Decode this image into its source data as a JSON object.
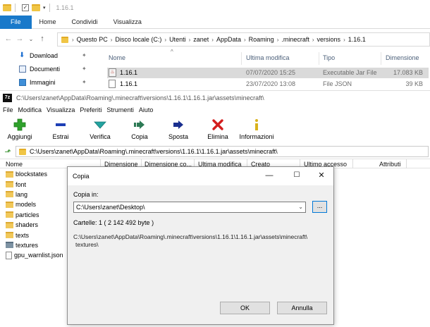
{
  "explorer": {
    "title": "1.16.1",
    "ribbon_tabs": [
      "File",
      "Home",
      "Condividi",
      "Visualizza"
    ],
    "breadcrumb": [
      "Questo PC",
      "Disco locale (C:)",
      "Utenti",
      "zanet",
      "AppData",
      "Roaming",
      ".minecraft",
      "versions",
      "1.16.1"
    ],
    "nav_items": [
      {
        "label": "Download",
        "icon": "download-icon"
      },
      {
        "label": "Documenti",
        "icon": "documents-icon"
      },
      {
        "label": "Immagini",
        "icon": "pictures-icon"
      }
    ],
    "columns": {
      "name": "Nome",
      "modified": "Ultima modifica",
      "type": "Tipo",
      "size": "Dimensione"
    },
    "files": [
      {
        "name": "1.16.1",
        "modified": "07/07/2020 15:25",
        "type": "Executable Jar File",
        "size": "17.083 KB",
        "selected": true
      },
      {
        "name": "1.16.1",
        "modified": "23/07/2020 13:08",
        "type": "File JSON",
        "size": "39 KB",
        "selected": false
      }
    ]
  },
  "zip": {
    "title": "C:\\Users\\zanet\\AppData\\Roaming\\.minecraft\\versions\\1.16.1\\1.16.1.jar\\assets\\minecraft\\",
    "menu": [
      "File",
      "Modifica",
      "Visualizza",
      "Preferiti",
      "Strumenti",
      "Aiuto"
    ],
    "toolbar": [
      {
        "label": "Aggiungi",
        "icon": "add-icon",
        "color": "#2fa12b"
      },
      {
        "label": "Estrai",
        "icon": "extract-icon",
        "color": "#1d3fb5"
      },
      {
        "label": "Verifica",
        "icon": "test-icon",
        "color": "#23a3a0"
      },
      {
        "label": "Copia",
        "icon": "copy-icon",
        "color": "#2d7a55"
      },
      {
        "label": "Sposta",
        "icon": "move-icon",
        "color": "#1a2f8f"
      },
      {
        "label": "Elimina",
        "icon": "delete-icon",
        "color": "#d31d1d"
      },
      {
        "label": "Informazioni",
        "icon": "info-icon",
        "color": "#d9b21c"
      }
    ],
    "path": "C:\\Users\\zanet\\AppData\\Roaming\\.minecraft\\versions\\1.16.1\\1.16.1.jar\\assets\\minecraft\\",
    "columns": [
      "Nome",
      "Dimensione",
      "Dimensione co...",
      "Ultima modifica",
      "Creato",
      "Ultimo accesso",
      "Attributi"
    ],
    "items": [
      {
        "name": "blockstates",
        "kind": "folder"
      },
      {
        "name": "font",
        "kind": "folder"
      },
      {
        "name": "lang",
        "kind": "folder"
      },
      {
        "name": "models",
        "kind": "folder"
      },
      {
        "name": "particles",
        "kind": "folder"
      },
      {
        "name": "shaders",
        "kind": "folder"
      },
      {
        "name": "texts",
        "kind": "folder"
      },
      {
        "name": "textures",
        "kind": "folder-selected"
      },
      {
        "name": "gpu_warnlist.json",
        "kind": "file"
      }
    ]
  },
  "dialog": {
    "title": "Copia",
    "copy_to_label": "Copia in:",
    "destination": "C:\\Users\\zanet\\Desktop\\",
    "browse_label": "...",
    "folders_count": "Cartelle: 1   ( 2 142 492 byte )",
    "source_line1": "C:\\Users\\zanet\\AppData\\Roaming\\.minecraft\\versions\\1.16.1\\1.16.1.jar\\assets\\minecraft\\",
    "source_line2": "textures\\",
    "ok_label": "OK",
    "cancel_label": "Annulla"
  }
}
